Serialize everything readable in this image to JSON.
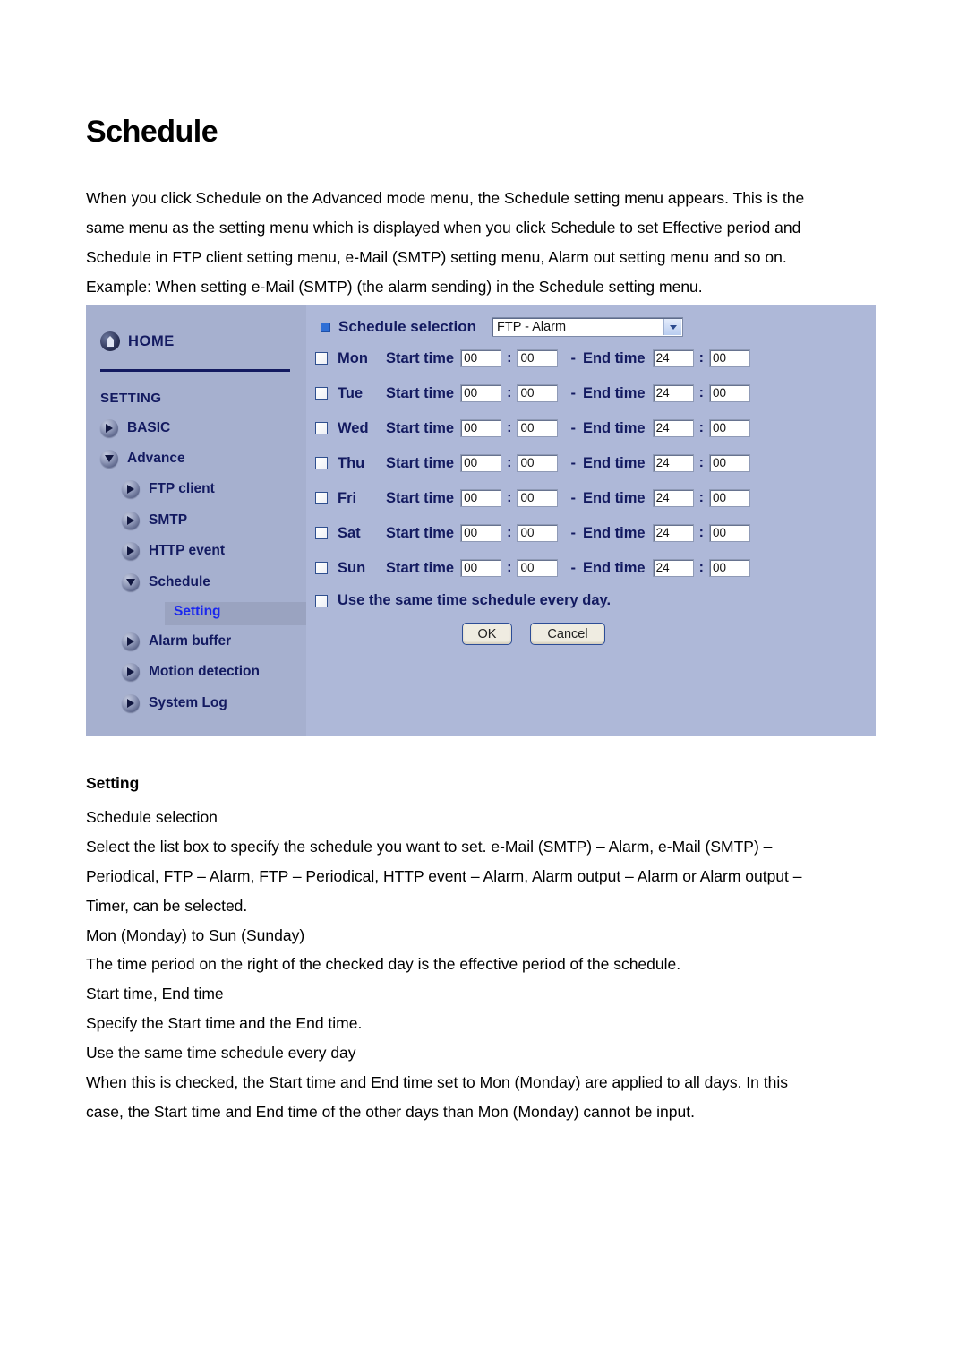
{
  "document": {
    "title": "Schedule",
    "intro": [
      "When you click Schedule on the Advanced mode menu, the Schedule setting menu appears. This is the",
      "same menu as the setting menu which is displayed when you click Schedule to set Effective period and",
      "Schedule in FTP client setting menu, e-Mail (SMTP) setting menu, Alarm out setting menu and so on.",
      "Example: When setting e-Mail (SMTP) (the alarm sending) in the Schedule setting menu."
    ],
    "section_heading": "Setting",
    "body_a": [
      "Schedule selection",
      "Select the list box to specify the schedule you want to set. e-Mail (SMTP) – Alarm, e-Mail (SMTP) –",
      "Periodical, FTP – Alarm, FTP – Periodical, HTTP event – Alarm, Alarm output – Alarm or Alarm output –",
      "Timer, can be selected.",
      "Mon (Monday) to Sun (Sunday)"
    ],
    "body_b": [
      "The time period on the right of the checked day is the effective period of the schedule.",
      "Start time, End time",
      "Specify the Start time and the End time.",
      "Use the same time schedule every day",
      "When this is checked, the Start time and End time set to Mon (Monday) are applied to all days. In this",
      "case,    the Start time and End time of the other days than Mon (Monday) cannot be input."
    ]
  },
  "screenshot": {
    "sidebar": {
      "home_label": "HOME",
      "home_icon": "house-icon",
      "setting_heading": "SETTING",
      "items": [
        {
          "label": "BASIC",
          "icon": "triangle-right-icon",
          "level": 1,
          "expanded": false
        },
        {
          "label": "Advance",
          "icon": "triangle-down-icon",
          "level": 1,
          "expanded": true
        },
        {
          "label": "FTP client",
          "icon": "triangle-right-icon",
          "level": 2,
          "expanded": false
        },
        {
          "label": "SMTP",
          "icon": "triangle-right-icon",
          "level": 2,
          "expanded": false
        },
        {
          "label": "HTTP event",
          "icon": "triangle-right-icon",
          "level": 2,
          "expanded": false
        },
        {
          "label": "Schedule",
          "icon": "triangle-down-icon",
          "level": 2,
          "expanded": true
        },
        {
          "label": "Alarm buffer",
          "icon": "triangle-right-icon",
          "level": 2,
          "expanded": false
        },
        {
          "label": "Motion detection",
          "icon": "triangle-right-icon",
          "level": 2,
          "expanded": false
        },
        {
          "label": "System Log",
          "icon": "triangle-right-icon",
          "level": 2,
          "expanded": false
        }
      ],
      "selected_sub_item": "Setting"
    },
    "main": {
      "schedule_selection_label": "Schedule selection",
      "schedule_selection_value": "FTP - Alarm",
      "schedule_selection_options": [
        "e-Mail (SMTP) - Alarm",
        "e-Mail (SMTP) - Periodical",
        "FTP - Alarm",
        "FTP - Periodical",
        "HTTP event - Alarm",
        "Alarm output - Alarm",
        "Alarm output - Timer"
      ],
      "start_time_label": "Start time",
      "end_time_label": "End time",
      "dash": "-",
      "colon": ":",
      "days": [
        {
          "name": "Mon",
          "checked": false,
          "start_h": "00",
          "start_m": "00",
          "end_h": "24",
          "end_m": "00"
        },
        {
          "name": "Tue",
          "checked": false,
          "start_h": "00",
          "start_m": "00",
          "end_h": "24",
          "end_m": "00"
        },
        {
          "name": "Wed",
          "checked": false,
          "start_h": "00",
          "start_m": "00",
          "end_h": "24",
          "end_m": "00"
        },
        {
          "name": "Thu",
          "checked": false,
          "start_h": "00",
          "start_m": "00",
          "end_h": "24",
          "end_m": "00"
        },
        {
          "name": "Fri",
          "checked": false,
          "start_h": "00",
          "start_m": "00",
          "end_h": "24",
          "end_m": "00"
        },
        {
          "name": "Sat",
          "checked": false,
          "start_h": "00",
          "start_m": "00",
          "end_h": "24",
          "end_m": "00"
        },
        {
          "name": "Sun",
          "checked": false,
          "start_h": "00",
          "start_m": "00",
          "end_h": "24",
          "end_m": "00"
        }
      ],
      "same_schedule_label": "Use the same time schedule every day.",
      "same_schedule_checked": false,
      "ok_label": "OK",
      "cancel_label": "Cancel"
    },
    "colors": {
      "sidebar_bg": "#a6b0cf",
      "main_bg": "#aeb8d8",
      "nav_text": "#131a60",
      "selected_text": "#1b28ee",
      "selected_band": "#9aa3c0",
      "field_bg": "#ffffff",
      "button_bg": "#efece1",
      "button_border": "#2c4d96",
      "bullet_square": "#2f6fd6"
    }
  }
}
